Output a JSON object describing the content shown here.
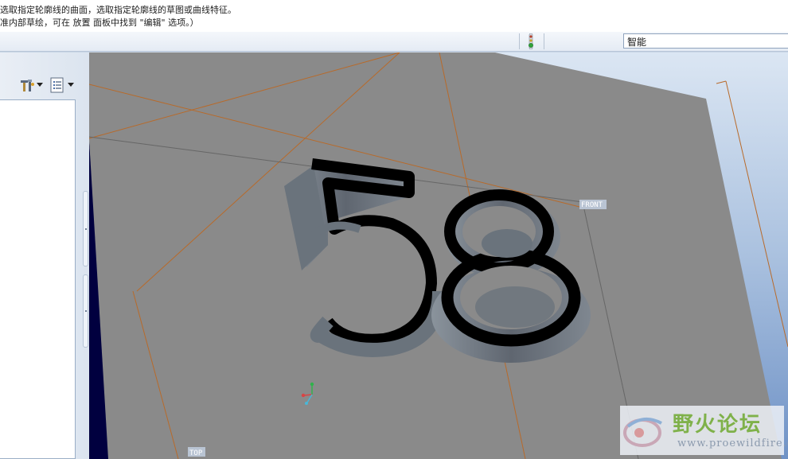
{
  "message_area": {
    "line1": "选取指定轮廓线的曲面，选取指定轮廓线的草图或曲线特征。",
    "line2": "准内部草绘，可在 放置 面板中找到 \"编辑\" 选项。）"
  },
  "status_bar": {
    "traffic_icon": "traffic-light-icon",
    "filter_value": "智能"
  },
  "left_panel": {
    "tools": [
      "show-tools-icon",
      "settings-list-icon",
      "dropdown-arrow-icon"
    ]
  },
  "viewport": {
    "model_text": "58",
    "datum_plane_labels": {
      "front": "FRONT",
      "bottom": "TOP"
    },
    "colors": {
      "background": "#8a8a8a",
      "dark_edge": "#01003f",
      "datum_line": "#b86a2a",
      "extrude_side": "#6c737c",
      "extrude_top": "#000000"
    }
  },
  "watermark": {
    "title": "野火论坛",
    "url": "www.proewildfire.cn"
  }
}
